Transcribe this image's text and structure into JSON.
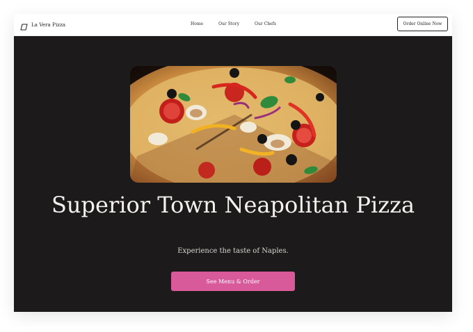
{
  "brand": {
    "name": "La Vera Pizza",
    "icon": "pizza-slice-icon"
  },
  "nav": {
    "items": [
      "Home",
      "Our Story",
      "Our Chefs"
    ]
  },
  "header": {
    "order_label": "Order Online Now"
  },
  "hero": {
    "title": "Superior Town Neapolitan Pizza",
    "subtitle": "Experience the taste of Naples.",
    "cta_label": "See Menu & Order"
  },
  "colors": {
    "background": "#1c1a1a",
    "accent": "#d95a9b",
    "nav_bg": "#ffffff"
  }
}
